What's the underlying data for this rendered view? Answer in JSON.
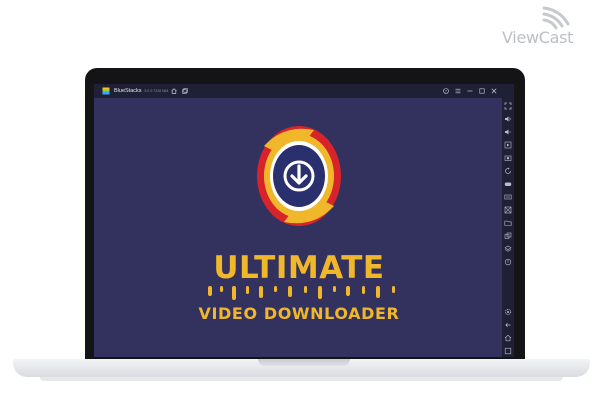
{
  "watermark": {
    "text": "ViewCast",
    "icon": "signal-waves-icon"
  },
  "window": {
    "title": "BlueStacks",
    "version": "5.0.0.7228 N64",
    "title_icons": [
      "home-icon",
      "multi-instance-icon"
    ],
    "controls": [
      "help-icon",
      "menu-icon",
      "minimize-icon",
      "maximize-icon",
      "close-icon"
    ]
  },
  "side_toolbar": {
    "tools": [
      "fullscreen-icon",
      "volume-up-icon",
      "volume-down-icon",
      "media-icon",
      "screenshot-icon",
      "rotate-icon",
      "gamepad-icon",
      "keyboard-icon",
      "expand-icon",
      "folder-icon",
      "multi-instance-icon",
      "layers-icon",
      "eco-mode-icon",
      "settings-icon",
      "back-icon",
      "home-icon",
      "recent-apps-icon"
    ]
  },
  "app": {
    "title": "ULTIMATE",
    "subtitle": "VIDEO DOWNLOADER"
  },
  "colors": {
    "background": "#33325f",
    "chrome": "#1f2035",
    "accent_yellow": "#f1b72a",
    "accent_red": "#d8232a",
    "logo_navy": "#2a2f6e"
  }
}
